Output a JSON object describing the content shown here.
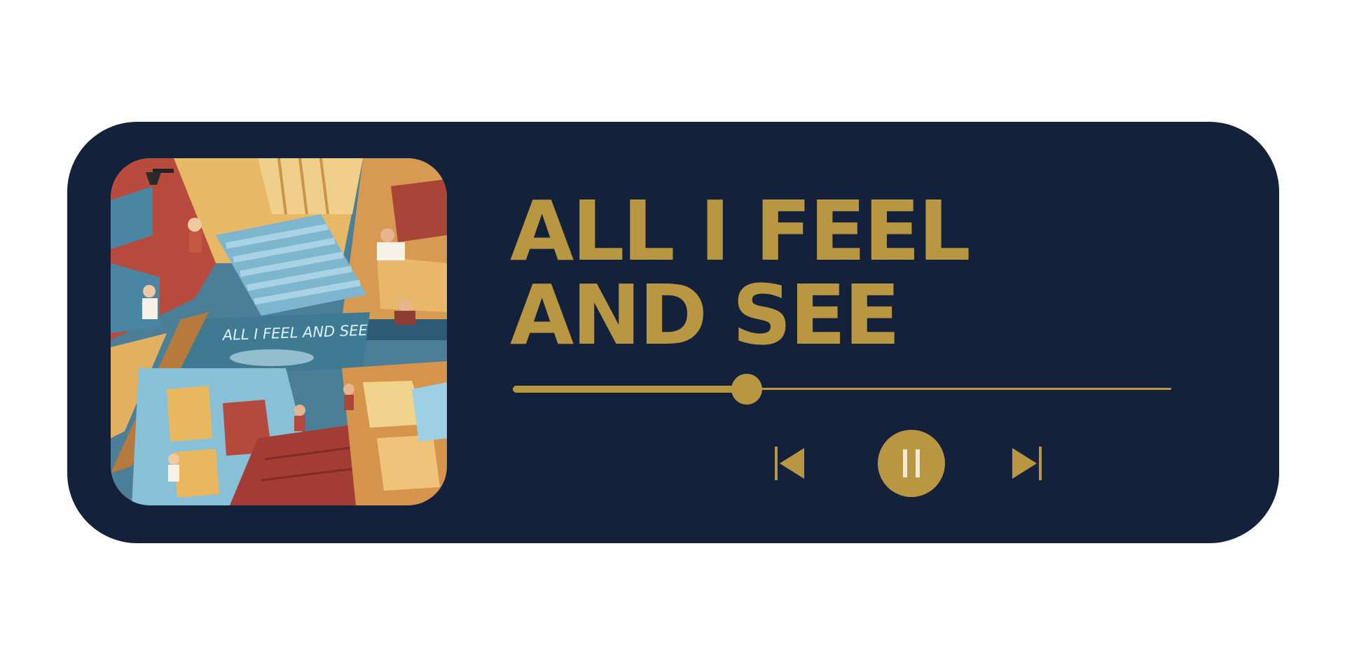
{
  "track": {
    "title_line1": "ALL I FEEL",
    "title_line2": "AND SEE",
    "cover_text": "ALL I FEEL AND SEE"
  },
  "playback": {
    "state": "playing",
    "progress_fraction": 0.355
  },
  "controls": {
    "previous_icon": "skip-previous-icon",
    "pause_icon": "pause-icon",
    "next_icon": "skip-next-icon"
  },
  "colors": {
    "card_background": "#13213a",
    "accent_gold": "#b89642",
    "page_background": "#ffffff"
  }
}
